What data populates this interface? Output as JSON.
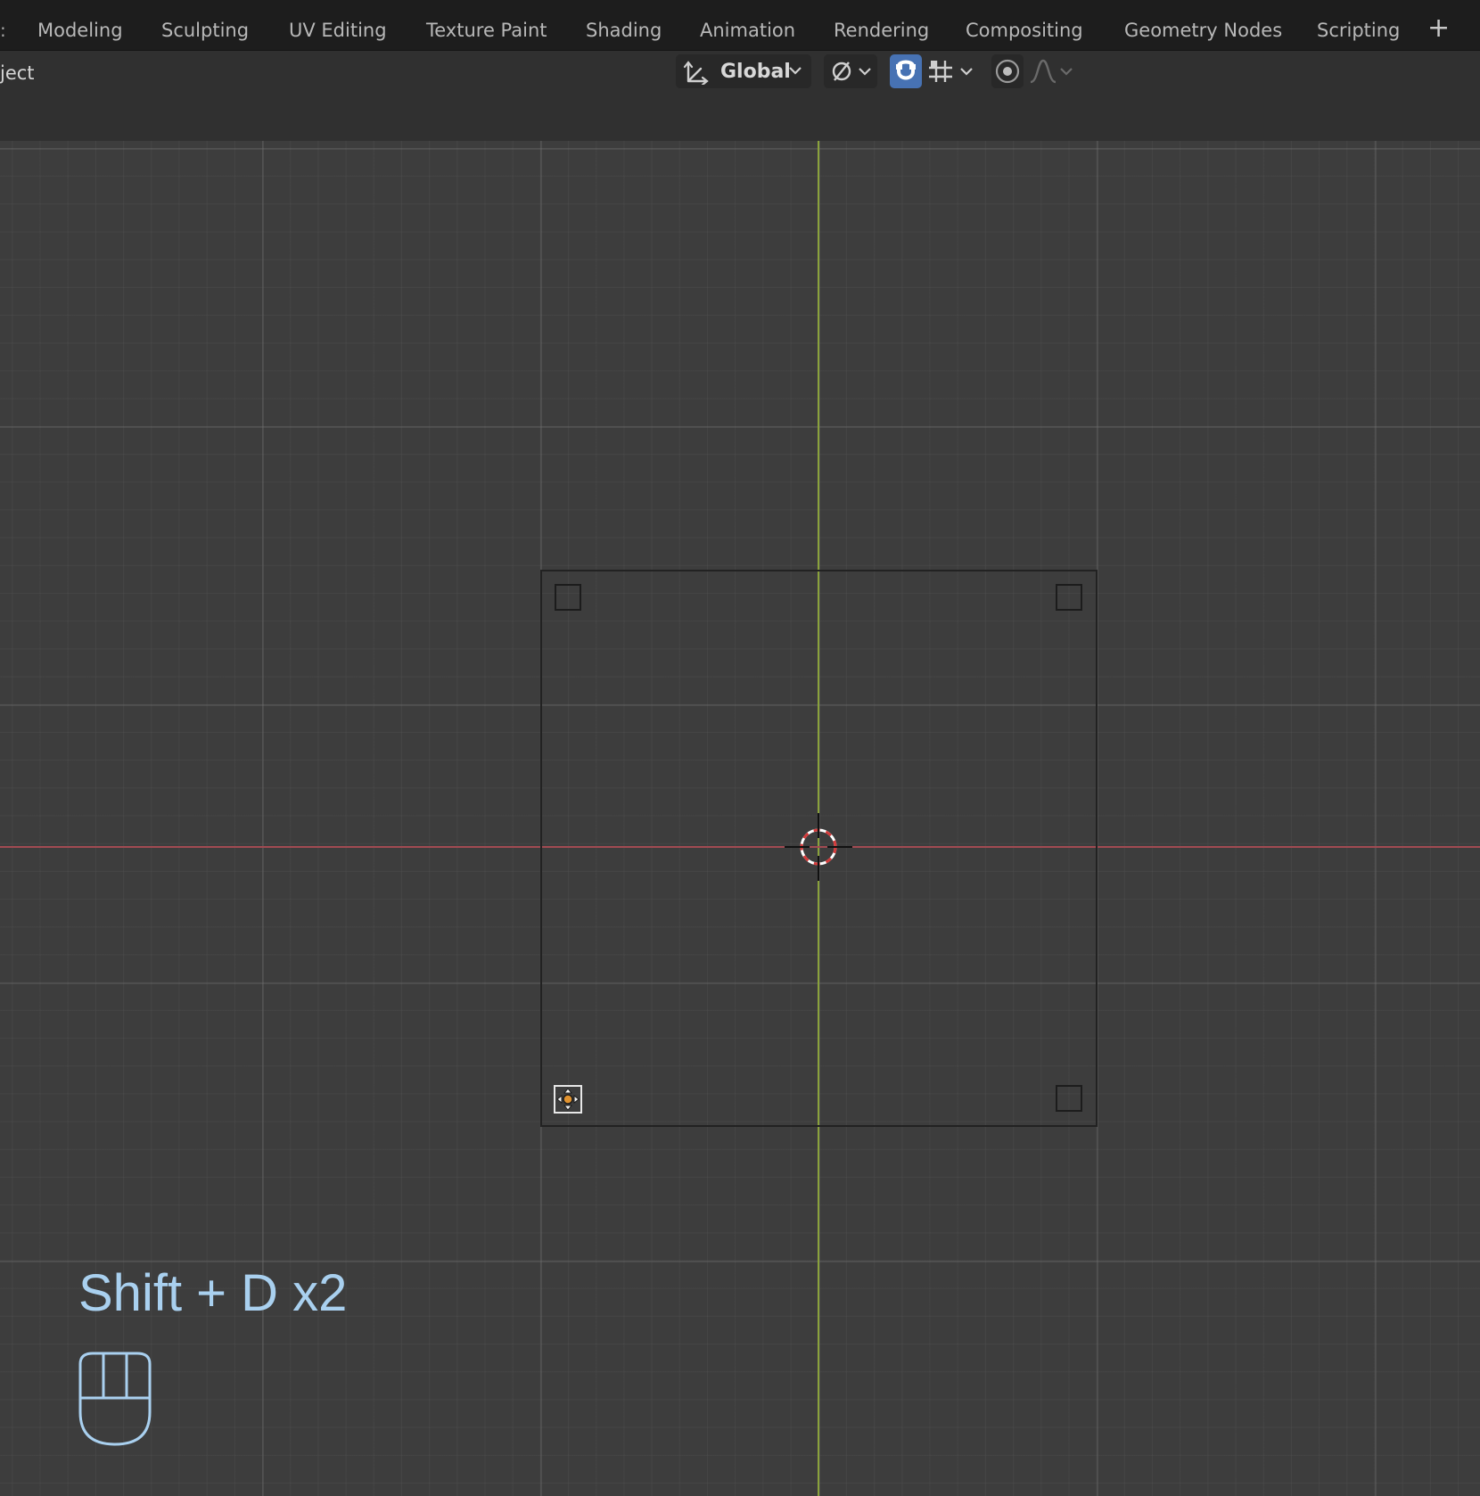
{
  "topbar": {
    "edge_fragment": ":",
    "tabs": [
      "Modeling",
      "Sculpting",
      "UV Editing",
      "Texture Paint",
      "Shading",
      "Animation",
      "Rendering",
      "Compositing",
      "Geometry Nodes",
      "Scripting"
    ],
    "add_label": "+"
  },
  "header": {
    "mode_fragment": "ject",
    "orientation": {
      "label": "Global",
      "icon": "transform-orientation-icon"
    },
    "pivot": {
      "icon": "pivot-point-icon"
    },
    "snap": {
      "icon": "magnet-icon",
      "active": true
    },
    "snap_target": {
      "icon": "snap-increment-icon"
    },
    "proportional": {
      "icon": "proportional-edit-icon"
    },
    "falloff": {
      "icon": "falloff-curve-icon"
    }
  },
  "viewport": {
    "overlay": {
      "shortcut": "Shift + D x2",
      "mouse_icon": "mouse-icon"
    },
    "object": "plane",
    "cursor_icon": "3d-cursor-icon"
  },
  "colors": {
    "accent": "#4772b3",
    "x_axis": "#a14a52",
    "y_axis": "#8aa23c",
    "overlay_text": "#a9d0ef"
  }
}
